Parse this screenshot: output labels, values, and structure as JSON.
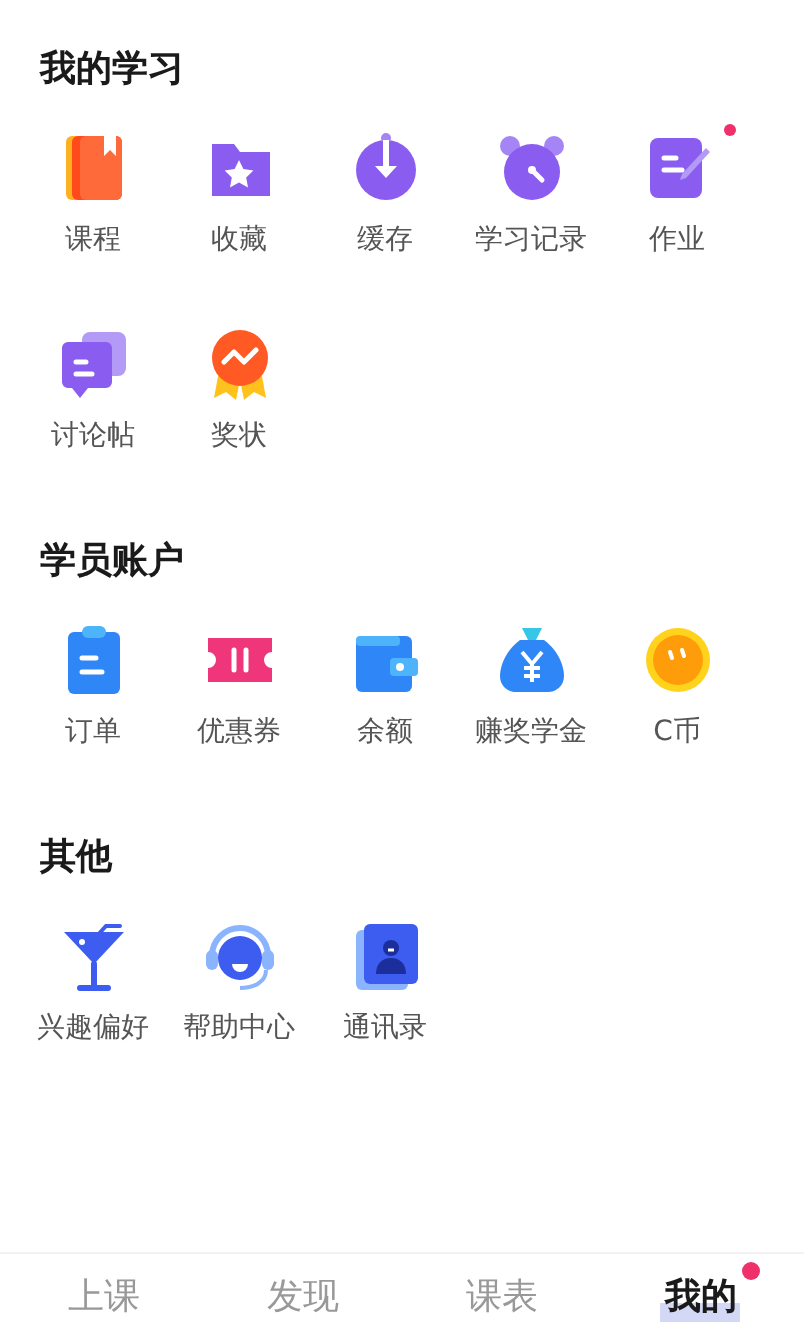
{
  "sections": [
    {
      "title": "我的学习",
      "items": [
        {
          "label": "课程",
          "kind": "book",
          "badge": false
        },
        {
          "label": "收藏",
          "kind": "folder-star",
          "badge": false
        },
        {
          "label": "缓存",
          "kind": "download",
          "badge": false
        },
        {
          "label": "学习记录",
          "kind": "alarm",
          "badge": false
        },
        {
          "label": "作业",
          "kind": "homework",
          "badge": true
        },
        {
          "label": "讨论帖",
          "kind": "chat",
          "badge": false
        },
        {
          "label": "奖状",
          "kind": "award",
          "badge": false
        }
      ]
    },
    {
      "title": "学员账户",
      "items": [
        {
          "label": "订单",
          "kind": "clipboard",
          "badge": false
        },
        {
          "label": "优惠券",
          "kind": "ticket",
          "badge": false
        },
        {
          "label": "余额",
          "kind": "wallet",
          "badge": false
        },
        {
          "label": "赚奖学金",
          "kind": "money-bag",
          "badge": false
        },
        {
          "label": "C币",
          "kind": "coin",
          "badge": false
        }
      ]
    },
    {
      "title": "其他",
      "items": [
        {
          "label": "兴趣偏好",
          "kind": "cocktail",
          "badge": false
        },
        {
          "label": "帮助中心",
          "kind": "headset",
          "badge": false
        },
        {
          "label": "通讯录",
          "kind": "contacts",
          "badge": false
        }
      ]
    }
  ],
  "tabs": [
    {
      "label": "上课",
      "selected": false,
      "badge": false
    },
    {
      "label": "发现",
      "selected": false,
      "badge": false
    },
    {
      "label": "课表",
      "selected": false,
      "badge": false
    },
    {
      "label": "我的",
      "selected": true,
      "badge": true
    }
  ]
}
